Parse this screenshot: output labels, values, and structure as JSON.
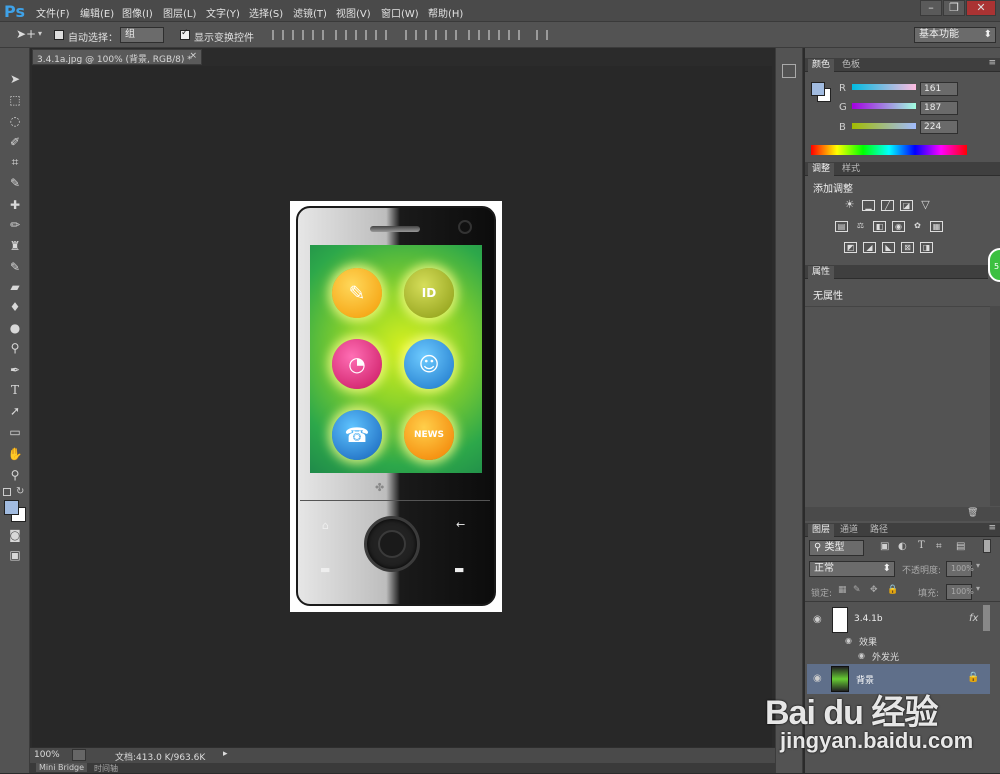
{
  "app": {
    "logo": "Ps"
  },
  "menu": [
    "文件(F)",
    "编辑(E)",
    "图像(I)",
    "图层(L)",
    "文字(Y)",
    "选择(S)",
    "滤镜(T)",
    "视图(V)",
    "窗口(W)",
    "帮助(H)"
  ],
  "options": {
    "auto_select_label": "自动选择：",
    "auto_select_value": "组",
    "show_transform_label": "显示变换控件",
    "workspace": "基本功能"
  },
  "document": {
    "tab_title": "3.4.1a.jpg @ 100% (背景, RGB/8) *",
    "zoom": "100%",
    "doc_info": "文档:413.0 K/963.6K"
  },
  "bottom_tabs": [
    "Mini Bridge",
    "时间轴"
  ],
  "color_panel": {
    "tabs": [
      "颜色",
      "色板"
    ],
    "r_label": "R",
    "g_label": "G",
    "b_label": "B",
    "r": "161",
    "g": "187",
    "b": "224",
    "foreground": "#a1bbe0"
  },
  "adjust_panel": {
    "tabs": [
      "调整",
      "样式"
    ],
    "title": "添加调整"
  },
  "props_panel": {
    "tabs": [
      "属性"
    ],
    "content": "无属性"
  },
  "layers_panel": {
    "tabs": [
      "图层",
      "通道",
      "路径"
    ],
    "filter_kind": "类型",
    "blend_mode": "正常",
    "opacity_label": "不透明度:",
    "opacity_value": "100%",
    "lock_label": "锁定:",
    "fill_label": "填充:",
    "fill_value": "100%",
    "layers": [
      {
        "name": "3.4.1b",
        "fx": "fx",
        "effects_label": "效果",
        "effect": "外发光"
      },
      {
        "name": "背景"
      }
    ]
  },
  "phone_apps": [
    "✎",
    "ID",
    "◔",
    "☺",
    "☎",
    "NEWS"
  ],
  "watermark": {
    "brand": "Bai du 经验",
    "url": "jingyan.baidu.com"
  },
  "badge": "5"
}
